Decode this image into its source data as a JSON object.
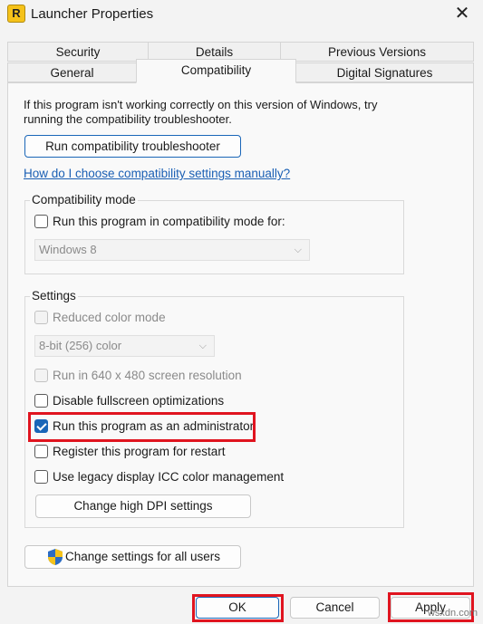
{
  "window": {
    "title": "Launcher Properties",
    "app_icon_letter": "R",
    "close_glyph": "✕"
  },
  "tabs_top": [
    {
      "label": "Security"
    },
    {
      "label": "Details"
    },
    {
      "label": "Previous Versions"
    }
  ],
  "tabs_bottom": [
    {
      "label": "General"
    },
    {
      "label": "Compatibility",
      "active": true
    },
    {
      "label": "Digital Signatures"
    }
  ],
  "intro_text": [
    "If this program isn't working correctly on this version of Windows, try",
    "running the compatibility troubleshooter."
  ],
  "troubleshooter_button": "Run compatibility troubleshooter",
  "help_link": "How do I choose compatibility settings manually?",
  "compatibility_mode": {
    "group_label": "Compatibility mode",
    "checkbox_label": "Run this program in compatibility mode for:",
    "checked": false,
    "os_select": "Windows 8"
  },
  "settings": {
    "group_label": "Settings",
    "reduced_color_label": "Reduced color mode",
    "color_select": "8-bit (256) color",
    "resolution_label": "Run in 640 x 480 screen resolution",
    "disable_fullscreen_label": "Disable fullscreen optimizations",
    "run_as_admin_label": "Run this program as an administrator",
    "run_as_admin_checked": true,
    "register_restart_label": "Register this program for restart",
    "legacy_icc_label": "Use legacy display ICC color management",
    "high_dpi_button": "Change high DPI settings"
  },
  "all_users_button": "Change settings for all users",
  "footer": {
    "ok": "OK",
    "cancel": "Cancel",
    "apply": "Apply"
  },
  "watermark": "wsxdn.com",
  "colors": {
    "accent": "#1a66b8",
    "highlight": "#e0141f",
    "link": "#1a5fb4"
  }
}
